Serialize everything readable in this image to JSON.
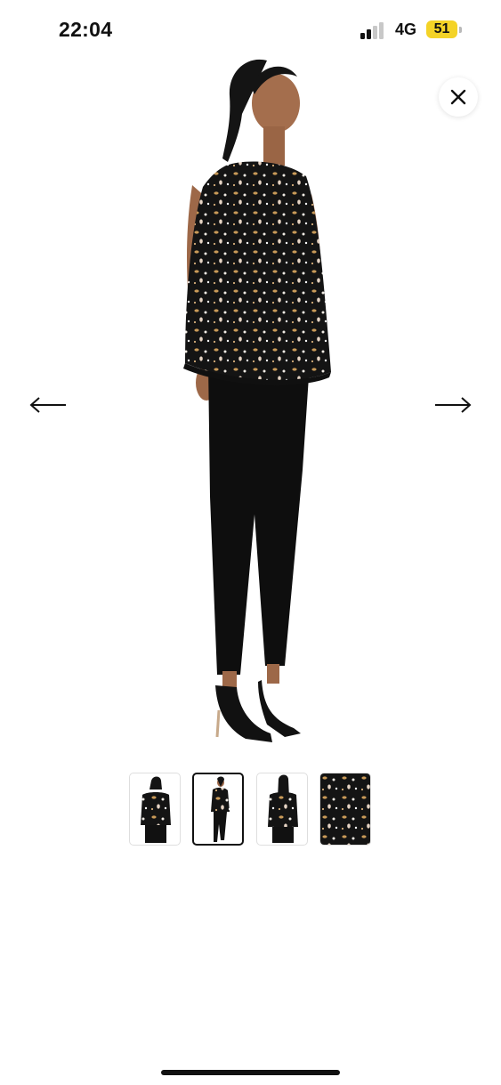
{
  "status_bar": {
    "time": "22:04",
    "network": "4G",
    "battery": "51",
    "signal_bars": 2,
    "battery_color": "#f4d327"
  },
  "gallery": {
    "close_icon": "close-icon",
    "prev_icon": "arrow-left-icon",
    "next_icon": "arrow-right-icon",
    "main_image": "model-side-view-floral-blouse-black-trousers",
    "selected_thumbnail": 2,
    "thumbnails": [
      {
        "image": "model-front-view"
      },
      {
        "image": "model-side-view"
      },
      {
        "image": "model-back-view"
      },
      {
        "image": "fabric-print-detail"
      }
    ]
  },
  "colors": {
    "background": "#ffffff",
    "garment": "#111111",
    "print_accents": [
      "#c99a58",
      "#e9dccf",
      "#f7f7f7"
    ]
  }
}
